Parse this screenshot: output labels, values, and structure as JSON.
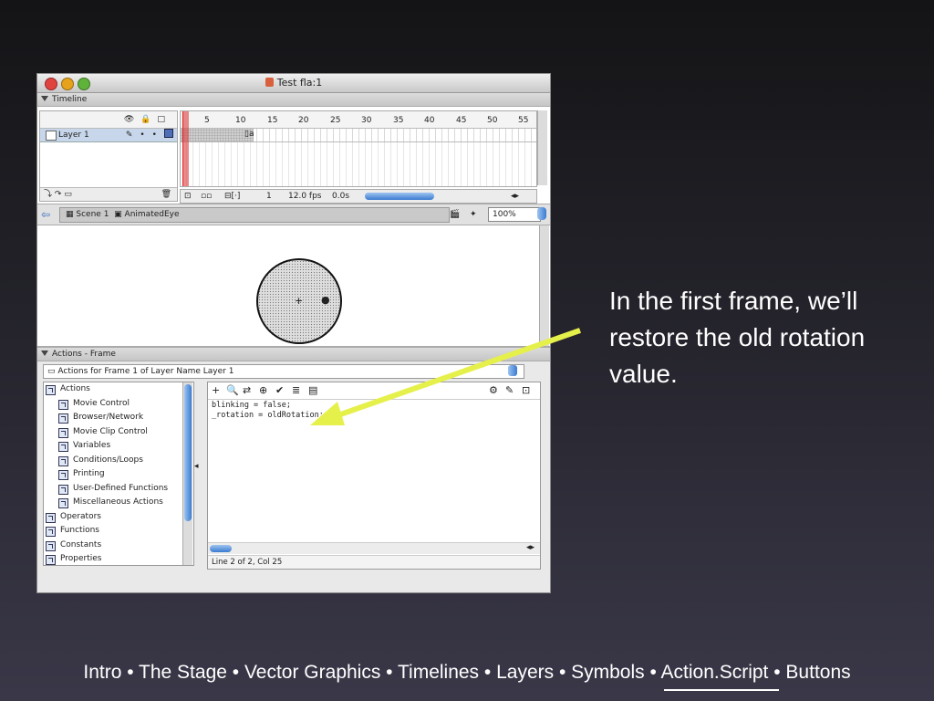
{
  "window": {
    "title": "Test fla:1"
  },
  "timeline": {
    "panel_title": "Timeline",
    "layer_name": "Layer 1",
    "ruler_ticks": [
      "5",
      "10",
      "15",
      "20",
      "25",
      "30",
      "35",
      "40",
      "45",
      "50",
      "55"
    ],
    "current_frame": "1",
    "fps": "12.0 fps",
    "time": "0.0s"
  },
  "scene": {
    "scene_name": "Scene 1",
    "symbol_name": "AnimatedEye",
    "zoom": "100%"
  },
  "actions": {
    "panel_title": "Actions - Frame",
    "selector": "Actions for Frame 1 of Layer Name Layer 1",
    "toolbox": [
      {
        "label": "Actions",
        "indent": 0
      },
      {
        "label": "Movie Control",
        "indent": 1
      },
      {
        "label": "Browser/Network",
        "indent": 1
      },
      {
        "label": "Movie Clip Control",
        "indent": 1
      },
      {
        "label": "Variables",
        "indent": 1
      },
      {
        "label": "Conditions/Loops",
        "indent": 1
      },
      {
        "label": "Printing",
        "indent": 1
      },
      {
        "label": "User-Defined Functions",
        "indent": 1
      },
      {
        "label": "Miscellaneous Actions",
        "indent": 1
      },
      {
        "label": "Operators",
        "indent": 0
      },
      {
        "label": "Functions",
        "indent": 0
      },
      {
        "label": "Constants",
        "indent": 0
      },
      {
        "label": "Properties",
        "indent": 0
      }
    ],
    "code_lines": [
      "blinking = false;",
      "_rotation = oldRotation;"
    ],
    "status": "Line 2 of 2, Col 25"
  },
  "caption": "In the first frame, we’ll restore the old rotation value.",
  "footer_nav": "Intro • The Stage • Vector Graphics • Timelines • Layers • Symbols • Action.Script • Buttons",
  "colors": {
    "arrow": "#e6f04a",
    "aqua_blue": "#3a7bd1",
    "layer_highlight": "#c7d6ea"
  }
}
